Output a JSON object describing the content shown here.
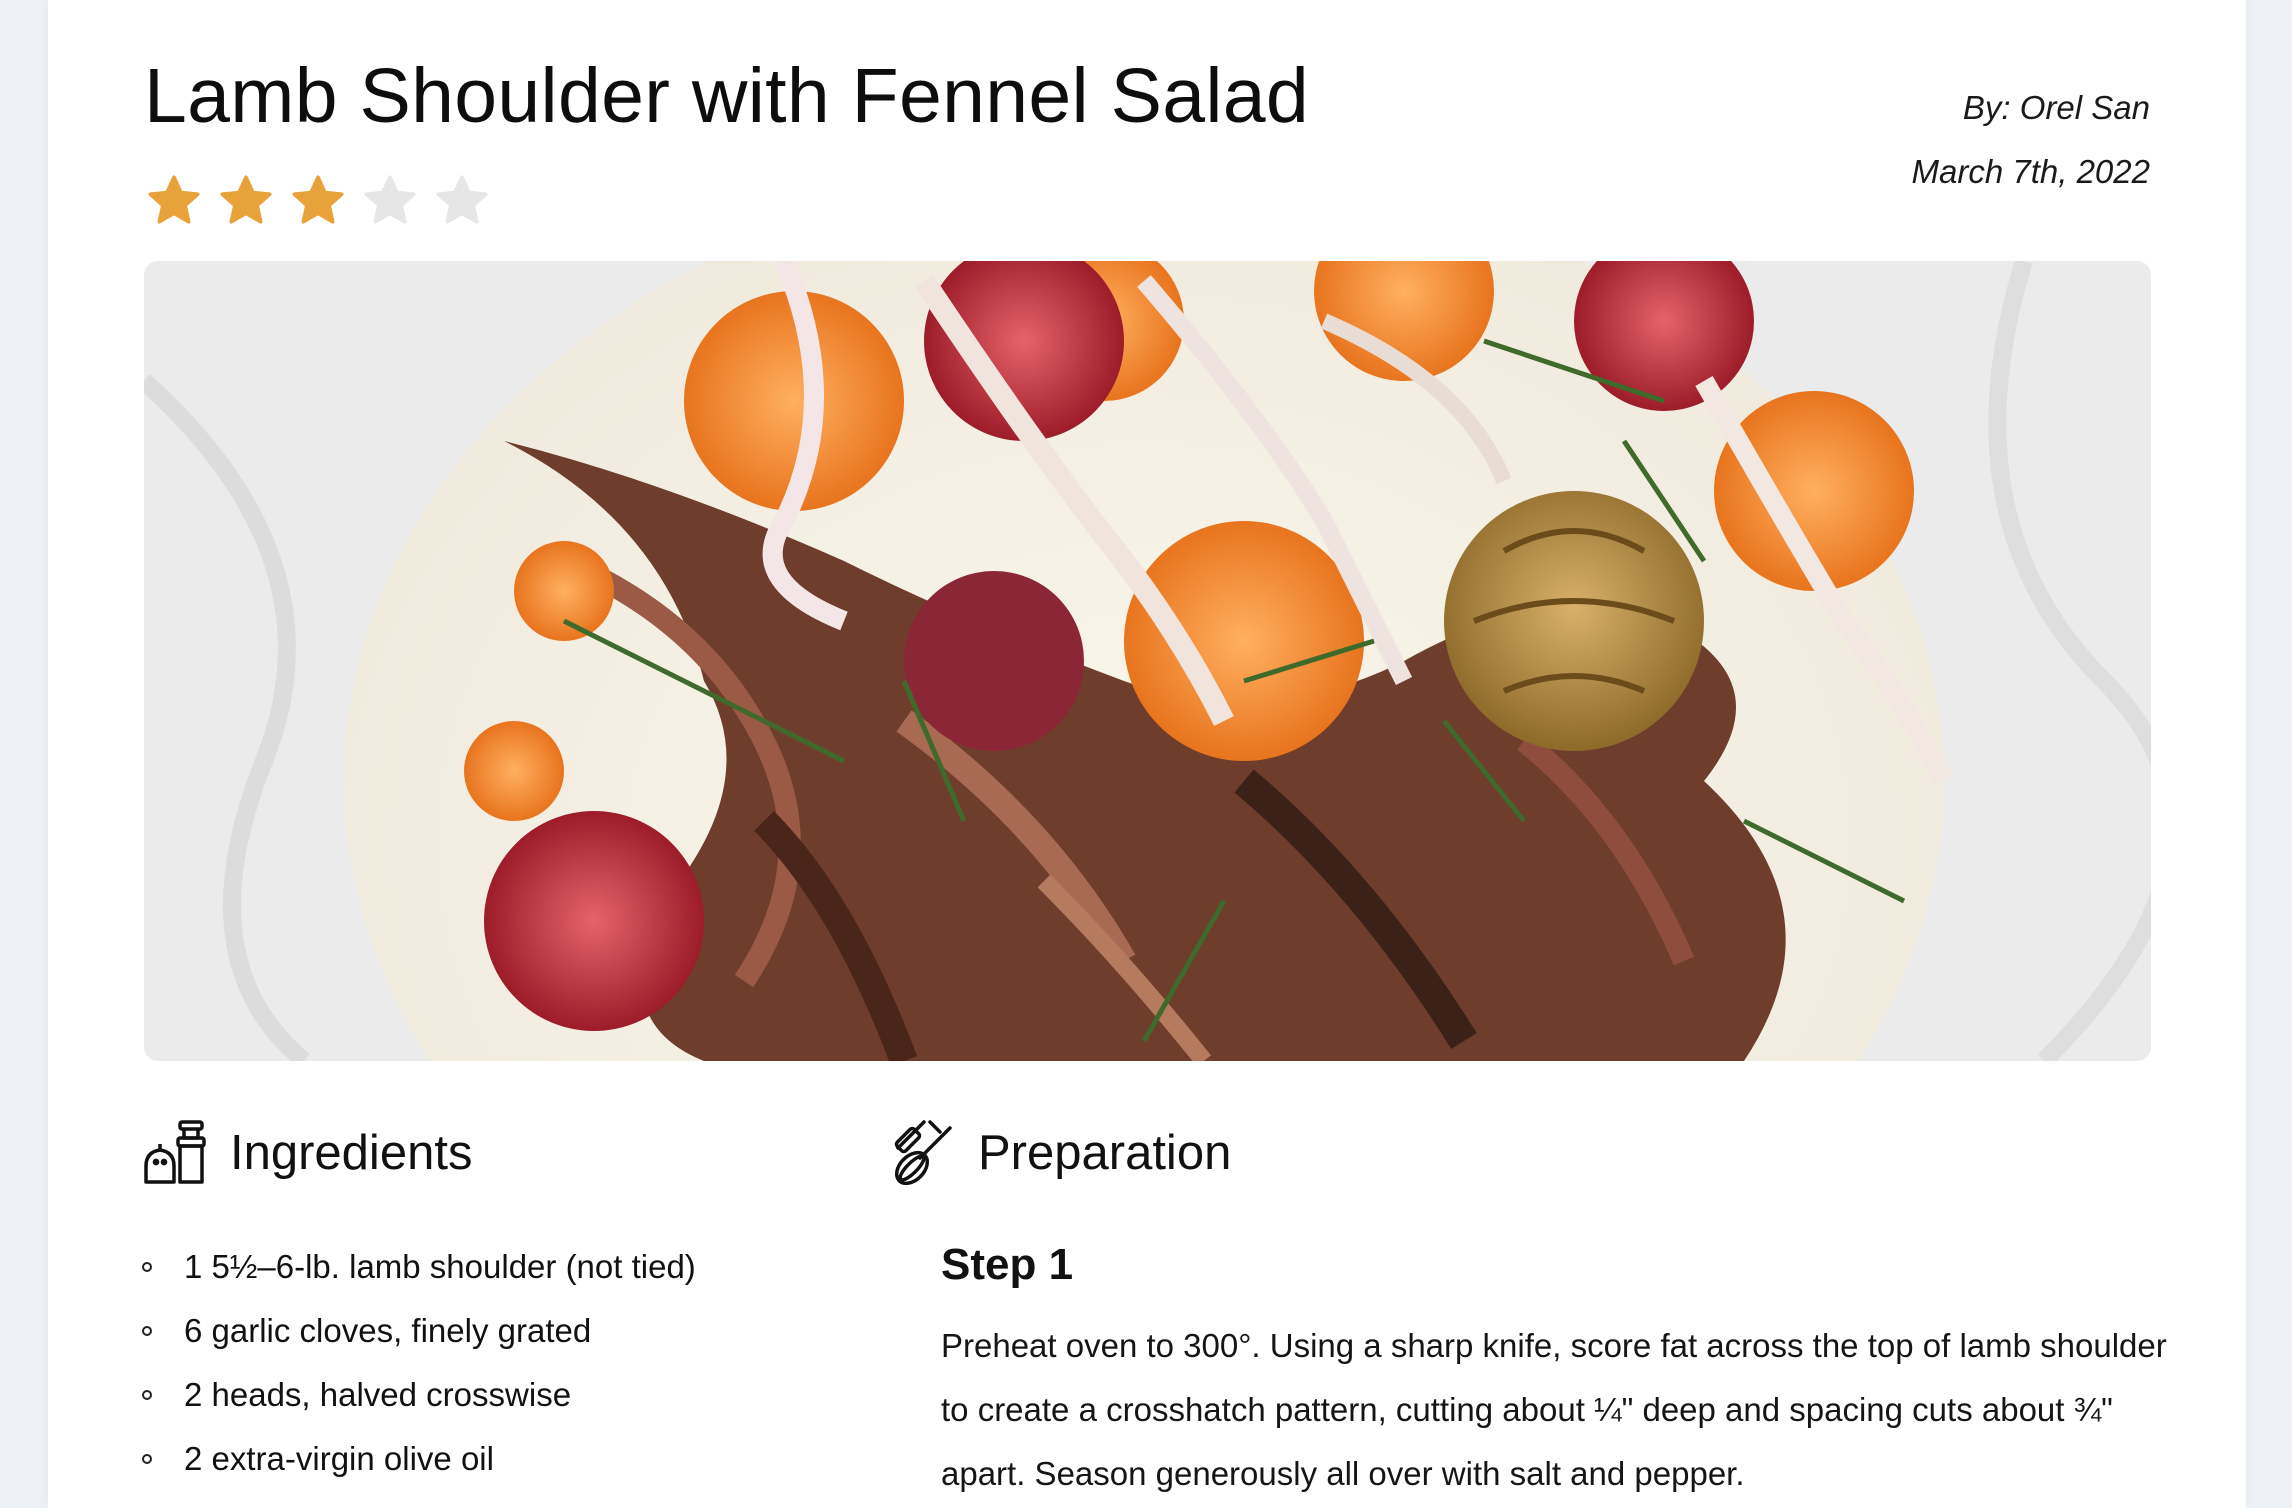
{
  "recipe": {
    "title": "Lamb Shoulder with Fennel Salad",
    "rating": 3,
    "max_rating": 5,
    "author": "By: Orel San",
    "date": "March 7th, 2022"
  },
  "colors": {
    "star_filled": "#e8a23a",
    "star_empty": "#e6e6e6",
    "page_background": "#eef1f6"
  },
  "hero_image": {
    "description": "Lamb shoulder with citrus and fennel salad on white plate"
  },
  "ingredients": {
    "icon": "salt-pepper-icon",
    "heading": "Ingredients",
    "items": [
      "1 5½–6-lb. lamb shoulder (not tied)",
      "6 garlic cloves, finely grated",
      "2 heads, halved crosswise",
      "2 extra-virgin olive oil"
    ]
  },
  "preparation": {
    "icon": "whisk-rolling-pin-icon",
    "heading": "Preparation",
    "steps": [
      {
        "title": "Step 1",
        "text": "Preheat oven to 300°. Using a sharp knife, score fat across the top of lamb shoulder to create a crosshatch pattern, cutting about ¼\" deep and spacing cuts about ¾\" apart. Season generously all over with salt and pepper."
      }
    ]
  }
}
